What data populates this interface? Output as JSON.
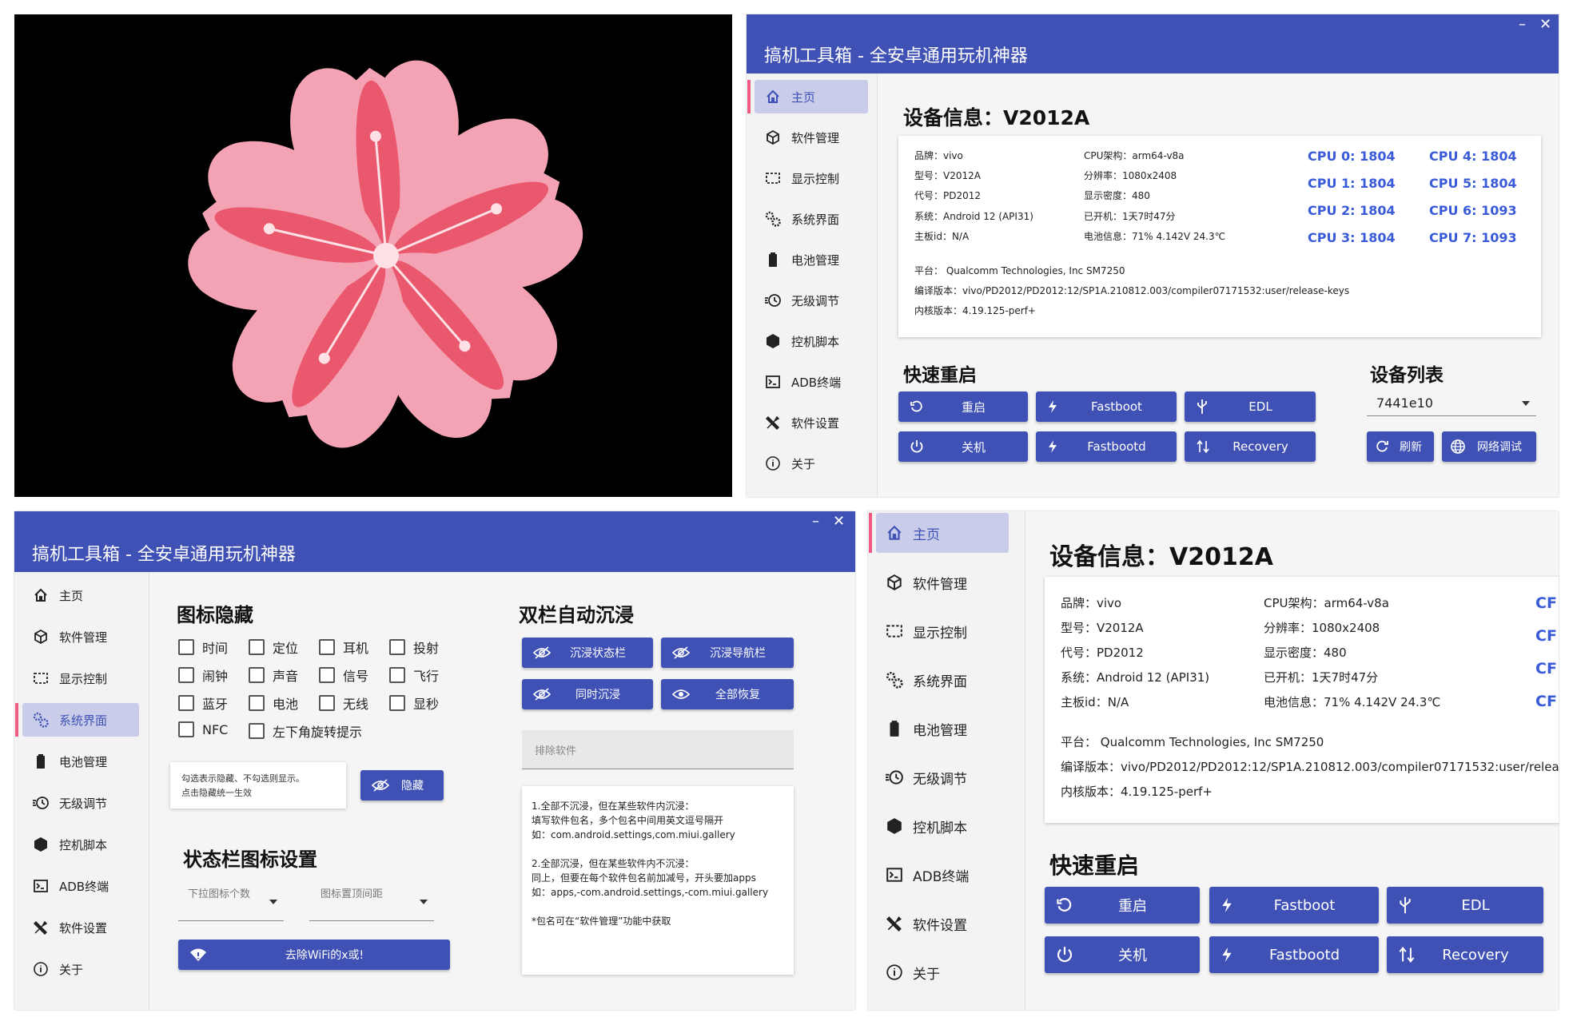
{
  "app": {
    "title": "搞机工具箱 - 全安卓通用玩机神器",
    "min_symbol": "–",
    "close_symbol": "✕"
  },
  "colors": {
    "primary": "#3f51b5",
    "accent": "#ef5b82",
    "cpu_text": "#3a5bd9"
  },
  "nav": [
    {
      "label": "主页",
      "icon": "home-icon"
    },
    {
      "label": "软件管理",
      "icon": "package-icon"
    },
    {
      "label": "显示控制",
      "icon": "screen-icon"
    },
    {
      "label": "系统界面",
      "icon": "gears-icon"
    },
    {
      "label": "电池管理",
      "icon": "battery-icon"
    },
    {
      "label": "无级调节",
      "icon": "timer-icon"
    },
    {
      "label": "控机脚本",
      "icon": "hexagon-icon"
    },
    {
      "label": "ADB终端",
      "icon": "terminal-icon"
    },
    {
      "label": "软件设置",
      "icon": "tools-icon"
    },
    {
      "label": "关于",
      "icon": "info-icon"
    }
  ],
  "home": {
    "device_title": "设备信息：V2012A",
    "info_left": [
      "品牌：vivo",
      "型号：V2012A",
      "代号：PD2012",
      "系统：Android 12 (API31)",
      "主板id：N/A"
    ],
    "info_mid": [
      "CPU架构：arm64-v8a",
      "分辨率：1080x2408",
      "显示密度：480",
      "已开机：1天7时47分",
      "电池信息：71%  4.142V  24.3℃"
    ],
    "info_bottom": [
      "平台：  Qualcomm Technologies, Inc SM7250",
      "编译版本：vivo/PD2012/PD2012:12/SP1A.210812.003/compiler07171532:user/release-keys",
      "内核版本：4.19.125-perf+"
    ],
    "cpu": [
      "CPU 0: 1804",
      "CPU 1: 1804",
      "CPU 2: 1804",
      "CPU 3: 1804",
      "CPU 4: 1804",
      "CPU 5: 1804",
      "CPU 6: 1093",
      "CPU 7: 1093"
    ],
    "cpu_partial": "CF",
    "quick_reboot": "快速重启",
    "reboot_buttons": [
      {
        "label": "重启",
        "icon": "restart-icon"
      },
      {
        "label": "Fastboot",
        "icon": "lightning-icon"
      },
      {
        "label": "EDL",
        "icon": "usb-icon"
      },
      {
        "label": "关机",
        "icon": "power-icon"
      },
      {
        "label": "Fastbootd",
        "icon": "lightning-icon"
      },
      {
        "label": "Recovery",
        "icon": "arrows-updown-icon"
      }
    ],
    "device_list_title": "设备列表",
    "device_selected": "7441e10",
    "refresh_label": "刷新",
    "network_label": "网络调试"
  },
  "system": {
    "icon_hide_title": "图标隐藏",
    "checkboxes": [
      "时间",
      "定位",
      "耳机",
      "投射",
      "闹钟",
      "声音",
      "信号",
      "飞行",
      "蓝牙",
      "电池",
      "无线",
      "显秒",
      "NFC",
      "左下角旋转提示"
    ],
    "hint_lines": [
      "勾选表示隐藏、不勾选则显示。",
      "点击隐藏统一生效"
    ],
    "hide_button": "隐藏",
    "statusbar_title": "状态栏图标设置",
    "select1": "下拉图标个数",
    "select2": "图标置顶间距",
    "wifi_button": "去除WiFi的x或!",
    "immersive_title": "双栏自动沉浸",
    "immersive_buttons": [
      "沉浸状态栏",
      "沉浸导航栏",
      "同时沉浸",
      "全部恢复"
    ],
    "exclude_placeholder": "排除软件",
    "notes": [
      "1.全部不沉浸，但在某些软件内沉浸：",
      "填写软件包名，多个包名中间用英文逗号隔开",
      "如：com.android.settings,com.miui.gallery",
      "",
      "2.全部沉浸，但在某些软件内不沉浸：",
      "同上，但要在每个软件包名前加减号，开头要加apps",
      "如：apps,-com.android.settings,-com.miui.gallery",
      "",
      "*包名可在“软件管理”功能中获取"
    ]
  }
}
